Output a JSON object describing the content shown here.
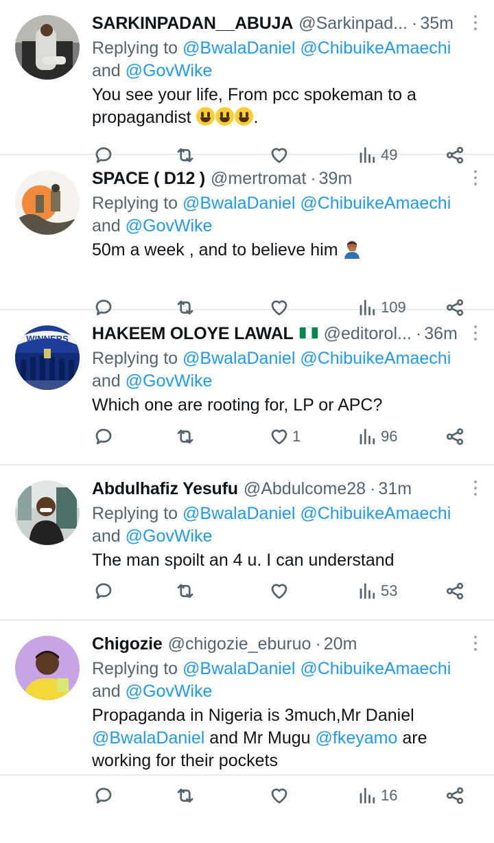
{
  "tweets": [
    {
      "name": "SARKINPADAN__ABUJA",
      "handle": "@Sarkinpad...",
      "time": "35m",
      "replying_prefix": "Replying to",
      "mention1": "@BwalaDaniel",
      "mention2": "@ChibuikeAmaechi",
      "and": "and",
      "mention3": "@GovWike",
      "text": "You see your life, From pcc spokeman to a propagandist",
      "text_suffix": ".",
      "likes": "",
      "views": "49"
    },
    {
      "name": "SPACE ( D12 )",
      "handle": "@mertromat",
      "time": "39m",
      "replying_prefix": "Replying to",
      "mention1": "@BwalaDaniel",
      "mention2": "@ChibuikeAmaechi",
      "and": "and",
      "mention3": "@GovWike",
      "text": "50m a week , and to believe him",
      "likes": "",
      "views": "109"
    },
    {
      "name": "HAKEEM OLOYE LAWAL",
      "handle": "@editorol...",
      "time": "36m",
      "replying_prefix": "Replying to",
      "mention1": "@BwalaDaniel",
      "mention2": "@ChibuikeAmaechi",
      "and": "and",
      "mention3": "@GovWike",
      "text": "Which one are rooting for, LP or APC?",
      "likes": "1",
      "views": "96",
      "avatar_text": "WINNERS"
    },
    {
      "name": "Abdulhafiz Yesufu",
      "handle": "@Abdulcome28",
      "time": "31m",
      "replying_prefix": "Replying to",
      "mention1": "@BwalaDaniel",
      "mention2": "@ChibuikeAmaechi",
      "and": "and",
      "mention3": "@GovWike",
      "text": "The man spoilt an 4 u. I can understand",
      "likes": "",
      "views": "53"
    },
    {
      "name": "Chigozie",
      "handle": "@chigozie_eburuo",
      "time": "20m",
      "replying_prefix": "Replying to",
      "mention1": "@BwalaDaniel",
      "mention2": "@ChibuikeAmaechi",
      "and": "and",
      "mention3": "@GovWike",
      "text_a": "Propaganda in Nigeria is 3much,Mr Daniel",
      "text_mention_a": "@BwalaDaniel",
      "text_b": "and Mr Mugu",
      "text_mention_b": "@fkeyamo",
      "text_c": "are working for their pockets",
      "likes": "",
      "views": "16"
    }
  ],
  "separator": "·",
  "icons": {
    "reply": "reply-bubble-icon",
    "retweet": "retweet-icon",
    "like": "heart-icon",
    "views": "views-bar-chart-icon",
    "share": "share-icon",
    "more": "more-vertical-icon"
  },
  "colors": {
    "link": "#1d9bf0",
    "secondary_text": "#536471",
    "primary_text": "#0f1419",
    "divider": "#e7e9ea"
  }
}
